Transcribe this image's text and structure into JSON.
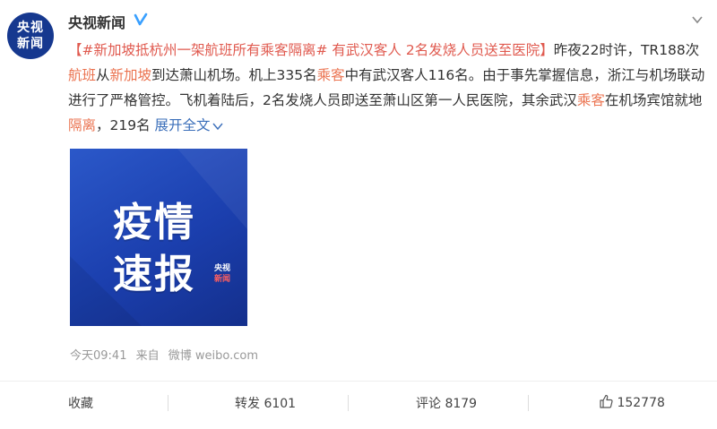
{
  "colors": {
    "accent_red": "#e05a4f",
    "link_blue": "#3b6fba",
    "avatar_bg": "#16388f",
    "verified_blue": "#3aa0ff"
  },
  "post": {
    "author": "央视新闻",
    "avatar_text": [
      "央视",
      "新闻"
    ],
    "verified_icon": "verified-badge-icon",
    "more_icon": "chevron-down-icon",
    "text": {
      "bracket_open": "【",
      "topic": "#新加坡抵杭州一架航班所有乘客隔离#",
      "headline": " 有武汉客人 2名发烧人员送至医院",
      "bracket_close": "】",
      "p1": "昨夜22时许，TR188次",
      "kw_flight": "航班",
      "p2": "从",
      "kw_singapore": "新加坡",
      "p3": "到达萧山机场。机上335名",
      "kw_passenger": "乘客",
      "p4": "中有武汉客人116名。由于事先掌握信息，浙江与机场联动进行了严格管控。飞机着陆后，2名发烧人员即送至萧山区第一人民医院，其余武汉",
      "kw_passenger2": "乘客",
      "p5": "在机场宾馆就地",
      "kw_isolate": "隔离",
      "p6": "，219名",
      "expand": "展开全文"
    },
    "image": {
      "title_line1": "疫情",
      "title_line2": "速报",
      "logo_line1": "央视",
      "logo_line2": "新闻"
    },
    "meta": {
      "time": "今天09:41",
      "from_label": "来自",
      "source": "微博 weibo.com"
    }
  },
  "actions": {
    "favorite": "收藏",
    "repost_label": "转发",
    "repost_count": "6101",
    "comment_label": "评论",
    "comment_count": "8179",
    "like_count": "152778",
    "like_icon": "thumbs-up-icon"
  }
}
